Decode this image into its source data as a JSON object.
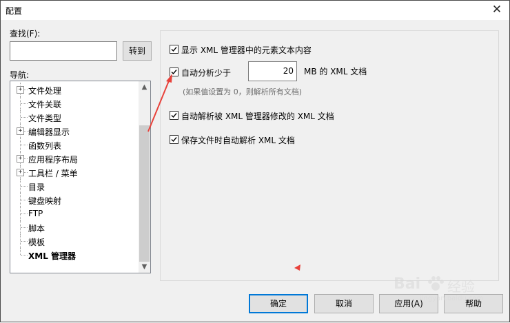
{
  "window": {
    "title": "配置",
    "close_symbol": "✕"
  },
  "search": {
    "label": "查找(F):",
    "value": "",
    "goto_label": "转到"
  },
  "nav": {
    "label": "导航:",
    "items": [
      {
        "label": "文件处理",
        "expandable": true
      },
      {
        "label": "文件关联",
        "expandable": false
      },
      {
        "label": "文件类型",
        "expandable": false
      },
      {
        "label": "编辑器显示",
        "expandable": true
      },
      {
        "label": "函数列表",
        "expandable": false
      },
      {
        "label": "应用程序布局",
        "expandable": true
      },
      {
        "label": "工具栏 / 菜单",
        "expandable": true
      },
      {
        "label": "目录",
        "expandable": false
      },
      {
        "label": "键盘映射",
        "expandable": false
      },
      {
        "label": "FTP",
        "expandable": false
      },
      {
        "label": "脚本",
        "expandable": false
      },
      {
        "label": "模板",
        "expandable": false
      },
      {
        "label": "XML 管理器",
        "expandable": false,
        "selected": true
      }
    ],
    "scroll_up": "▲",
    "scroll_down": "▼"
  },
  "settings": {
    "show_text": {
      "label": "显示 XML 管理器中的元素文本内容",
      "checked": true
    },
    "auto_parse_limit": {
      "label": "自动分析少于",
      "checked": true,
      "value": "20",
      "suffix": "MB 的 XML 文档"
    },
    "hint": "(如果值设置为 0，则解析所有文档)",
    "auto_parse_modified": {
      "label": "自动解析被 XML 管理器修改的 XML 文档",
      "checked": true
    },
    "auto_parse_on_save": {
      "label": "保存文件时自动解析 XML 文档",
      "checked": true
    }
  },
  "buttons": {
    "ok": "确定",
    "cancel": "取消",
    "apply": "应用(A)",
    "help": "帮助"
  },
  "watermark": {
    "text": "Bai",
    "text2": "经验",
    "url": "jingyan.baidu.com"
  },
  "colors": {
    "accent": "#0078d7",
    "annotation_red": "#e8413a"
  }
}
